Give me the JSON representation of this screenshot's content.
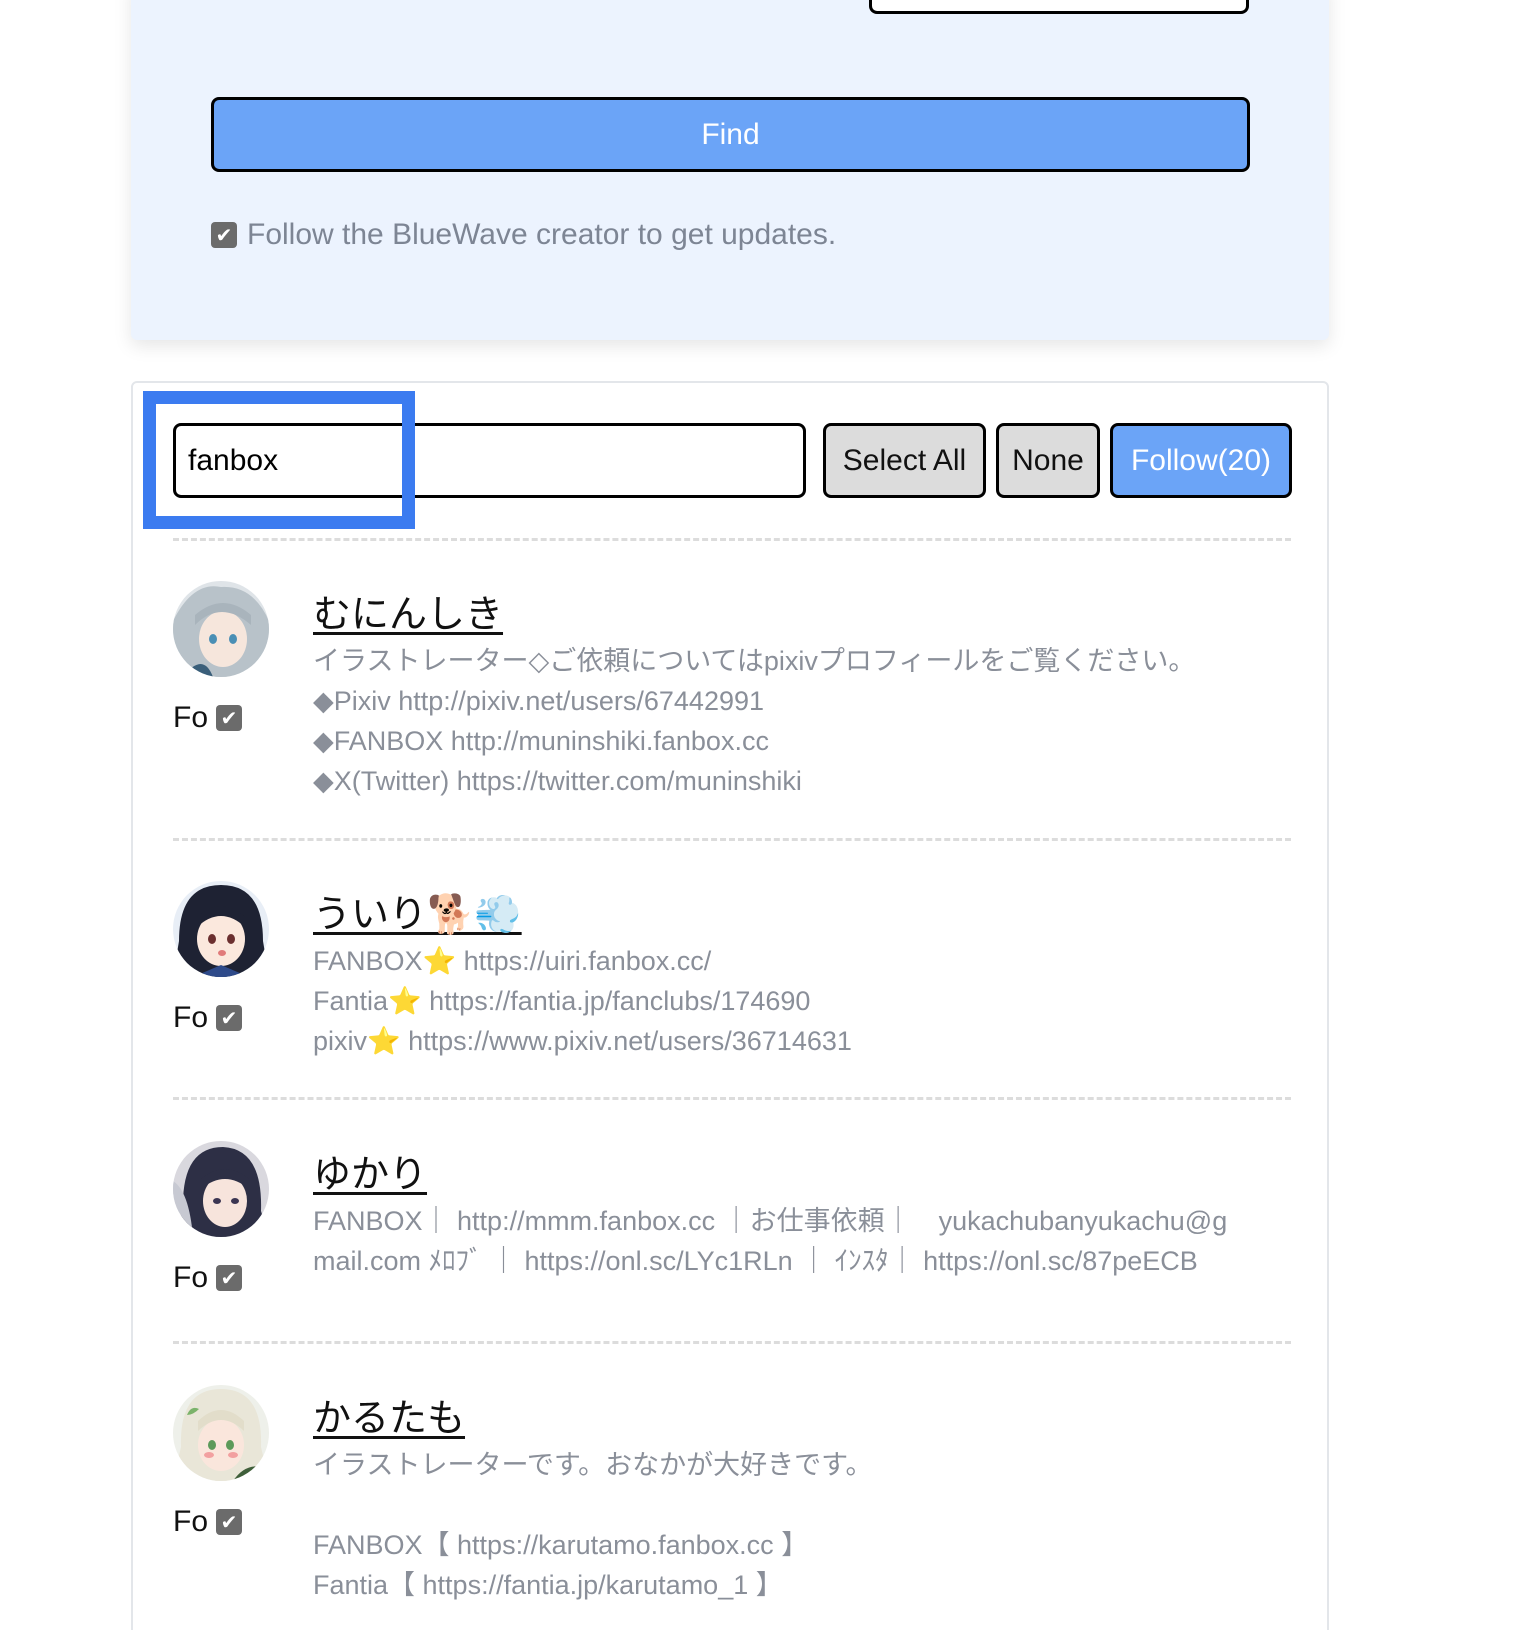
{
  "top_card": {
    "find_label": "Find",
    "follow_creator_label": "Follow the BlueWave creator to get updates.",
    "follow_creator_checked": true
  },
  "filter": {
    "value": "fanbox",
    "placeholder": ""
  },
  "buttons": {
    "select_all": "Select All",
    "none": "None",
    "follow": "Follow(20)"
  },
  "colors": {
    "accent": "#6ba4f7",
    "highlight": "#3b7bf0",
    "card_bg": "#ecf3fe",
    "muted_text": "#8a8f99"
  },
  "creators": [
    {
      "name": "むにんしき",
      "follow_label": "Fo",
      "checked": true,
      "description": [
        "イラストレーター◇ご依頼についてはpixivプロフィールをご覧ください。",
        "◆Pixiv http://pixiv.net/users/67442991",
        "◆FANBOX http://muninshiki.fanbox.cc",
        "◆X(Twitter) https://twitter.com/muninshiki"
      ]
    },
    {
      "name": "ういり🐕💨",
      "follow_label": "Fo",
      "checked": true,
      "description": [
        "FANBOX⭐ https://uiri.fanbox.cc/",
        "Fantia⭐ https://fantia.jp/fanclubs/174690",
        "pixiv⭐ https://www.pixiv.net/users/36714631"
      ]
    },
    {
      "name": "ゆかり",
      "follow_label": "Fo",
      "checked": true,
      "description": [
        "FANBOX｜ http://mmm.fanbox.cc ｜お仕事依頼｜　yukachubanyukachu@g",
        "mail.com ﾒﾛﾌﾞ ｜ https://onl.sc/LYc1RLn ｜ ｲﾝｽﾀ｜ https://onl.sc/87peECB"
      ]
    },
    {
      "name": "かるたも",
      "follow_label": "Fo",
      "checked": true,
      "description": [
        "イラストレーターです。おなかが大好きです。",
        "",
        "FANBOX【 https://karutamo.fanbox.cc 】",
        "Fantia【 https://fantia.jp/karutamo_1 】"
      ]
    }
  ]
}
